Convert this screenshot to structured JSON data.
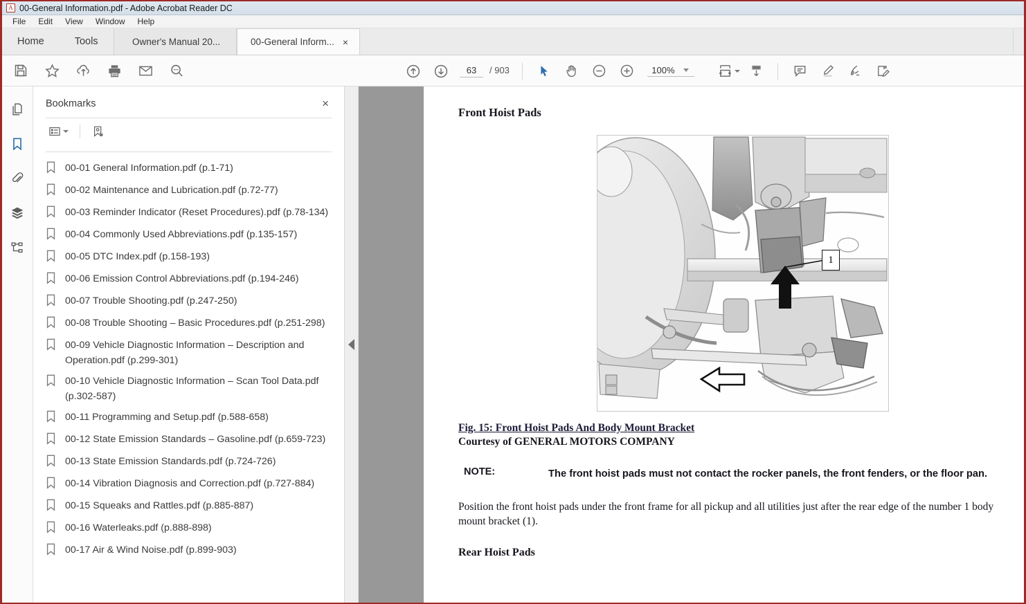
{
  "window": {
    "title": "00-General Information.pdf - Adobe Acrobat Reader DC",
    "app_icon": "acrobat-icon"
  },
  "menu": {
    "items": [
      {
        "label": "File"
      },
      {
        "label": "Edit"
      },
      {
        "label": "View"
      },
      {
        "label": "Window"
      },
      {
        "label": "Help"
      }
    ]
  },
  "tabs": {
    "nav": [
      {
        "label": "Home"
      },
      {
        "label": "Tools"
      }
    ],
    "documents": [
      {
        "label": "Owner's Manual 20...",
        "active": false
      },
      {
        "label": "00-General Inform...",
        "active": true,
        "close": "×"
      }
    ]
  },
  "toolbar": {
    "left": [
      {
        "name": "save-file-icon",
        "label": "Save File"
      },
      {
        "name": "star-icon",
        "label": "Add to Favorites"
      },
      {
        "name": "cloud-upload-icon",
        "label": "Upload to Cloud"
      },
      {
        "name": "print-icon",
        "label": "Print File"
      },
      {
        "name": "email-icon",
        "label": "Send File by Email"
      },
      {
        "name": "search-icon",
        "label": "Find Text"
      }
    ],
    "navigation": {
      "previous_page": "Previous Page",
      "next_page": "Next Page",
      "page_value": "63",
      "page_total": "/ 903"
    },
    "tools": {
      "select_tool": "Select Tool",
      "hand_tool": "Hand Tool",
      "zoom_out": "Zoom Out",
      "zoom_in": "Zoom In",
      "zoom_value": "100%"
    },
    "right": [
      {
        "name": "fit-width-icon",
        "label": "Fit Page Width"
      },
      {
        "name": "scroll-mode-icon",
        "label": "Scrolling Mode"
      },
      {
        "name": "comment-icon",
        "label": "Add Comment"
      },
      {
        "name": "highlight-icon",
        "label": "Highlight Text"
      },
      {
        "name": "sign-icon",
        "label": "Sign Document"
      },
      {
        "name": "fill-sign-icon",
        "label": "Fill & Sign"
      }
    ]
  },
  "rail": {
    "items": [
      {
        "name": "page-thumbnails-icon",
        "label": "Page Thumbnails",
        "active": false
      },
      {
        "name": "bookmarks-icon",
        "label": "Bookmarks",
        "active": true
      },
      {
        "name": "attachments-icon",
        "label": "Attachments",
        "active": false
      },
      {
        "name": "layers-icon",
        "label": "Layers",
        "active": false
      },
      {
        "name": "tags-icon",
        "label": "Tags",
        "active": false
      }
    ]
  },
  "bookmarks_panel": {
    "title": "Bookmarks",
    "close": "×",
    "options_label": "Options",
    "new_bookmark_label": "New Bookmark",
    "items": [
      {
        "label": "00-01 General Information.pdf (p.1-71)"
      },
      {
        "label": "00-02 Maintenance and Lubrication.pdf (p.72-77)"
      },
      {
        "label": "00-03 Reminder Indicator (Reset Procedures).pdf (p.78-134)"
      },
      {
        "label": "00-04 Commonly Used Abbreviations.pdf (p.135-157)"
      },
      {
        "label": "00-05 DTC Index.pdf (p.158-193)"
      },
      {
        "label": "00-06 Emission Control Abbreviations.pdf (p.194-246)"
      },
      {
        "label": "00-07 Trouble Shooting.pdf (p.247-250)"
      },
      {
        "label": "00-08 Trouble Shooting – Basic Procedures.pdf (p.251-298)"
      },
      {
        "label": "00-09 Vehicle Diagnostic Information – Description and Operation.pdf (p.299-301)"
      },
      {
        "label": "00-10 Vehicle Diagnostic Information – Scan Tool Data.pdf (p.302-587)"
      },
      {
        "label": "00-11 Programming and Setup.pdf (p.588-658)"
      },
      {
        "label": "00-12 State Emission Standards – Gasoline.pdf (p.659-723)"
      },
      {
        "label": "00-13 State Emission Standards.pdf (p.724-726)"
      },
      {
        "label": "00-14 Vibration Diagnosis and Correction.pdf (p.727-884)"
      },
      {
        "label": "00-15 Squeaks and Rattles.pdf (p.885-887)"
      },
      {
        "label": "00-16 Waterleaks.pdf (p.888-898)"
      },
      {
        "label": "00-17 Air & Wind Noise.pdf (p.899-903)"
      }
    ]
  },
  "document": {
    "heading": "Front Hoist Pads",
    "figure": {
      "alt": "Vehicle undercarriage showing front hoist pads and body mount bracket",
      "callout": "1",
      "caption": "Fig. 15: Front Hoist Pads And Body Mount Bracket",
      "courtesy": "Courtesy of GENERAL MOTORS COMPANY"
    },
    "note": {
      "label": "NOTE:",
      "text": "The front hoist pads must not contact the rocker panels, the front fenders, or the floor pan."
    },
    "paragraph": "Position the front hoist pads under the front frame for all pickup and all utilities just after the rear edge of the number 1 body mount bracket (1).",
    "subheading": "Rear Hoist Pads"
  },
  "colors": {
    "window_border": "#9e2a26",
    "titlebar": "#d9e3ed",
    "accent_blue": "#2f6fad",
    "page_backdrop": "#989898",
    "caption_navy": "#1b1b38"
  }
}
